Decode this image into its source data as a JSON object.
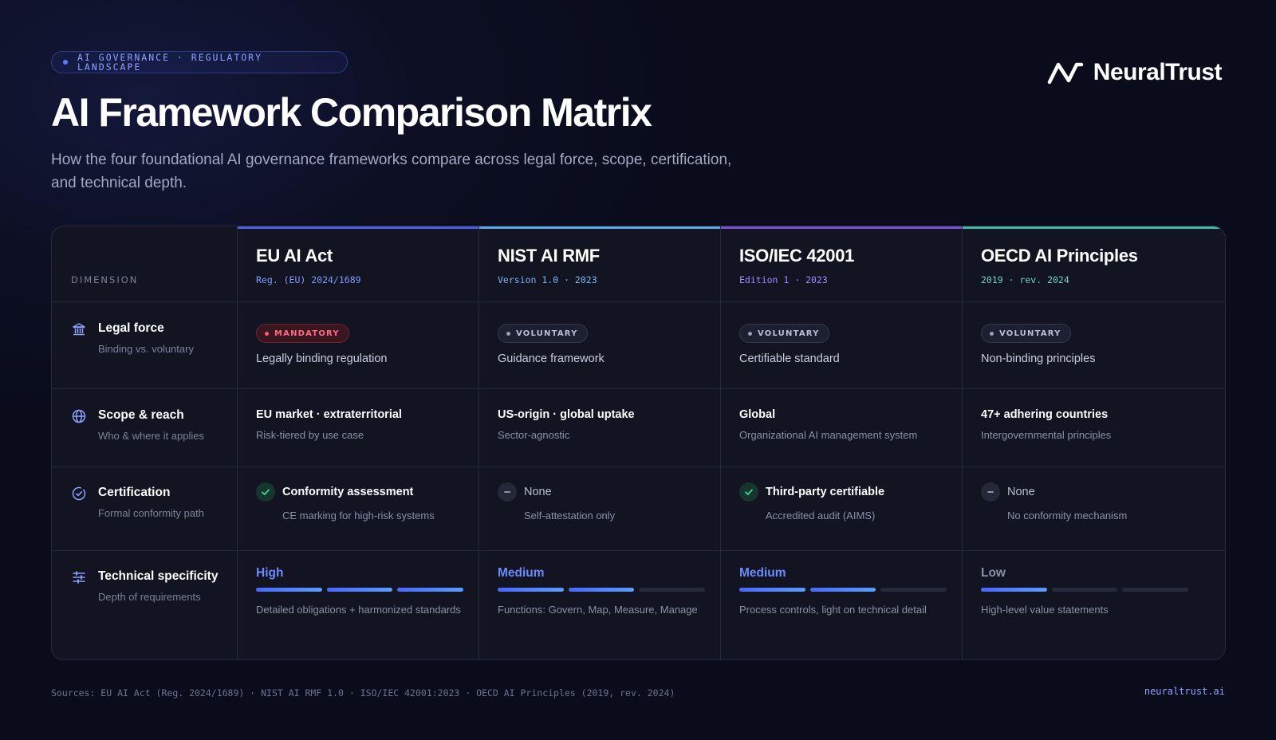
{
  "eyebrow": "AI GOVERNANCE · REGULATORY LANDSCAPE",
  "title": "AI Framework Comparison Matrix",
  "subtitle": "How the four foundational AI governance frameworks compare across legal force, scope, certification, and technical depth.",
  "brand": "NeuralTrust",
  "dimension_label": "DIMENSION",
  "frameworks": [
    {
      "name": "EU AI Act",
      "meta": "Reg. (EU) 2024/1689",
      "accent": "#4a5fe6",
      "meta_color": "#7f9bff"
    },
    {
      "name": "NIST AI RMF",
      "meta": "Version 1.0 · 2023",
      "accent": "#5aa8e8",
      "meta_color": "#7fb6f5"
    },
    {
      "name": "ISO/IEC 42001",
      "meta": "Edition 1 · 2023",
      "accent": "#7a4fd8",
      "meta_color": "#9d8bff"
    },
    {
      "name": "OECD AI Principles",
      "meta": "2019 · rev. 2024",
      "accent": "#3fb8a8",
      "meta_color": "#6fd4c4"
    }
  ],
  "rows": {
    "legal": {
      "title": "Legal force",
      "subtitle": "Binding vs. voluntary",
      "icon": "institution-icon"
    },
    "scope": {
      "title": "Scope & reach",
      "subtitle": "Who & where it applies",
      "icon": "globe-icon"
    },
    "cert": {
      "title": "Certification",
      "subtitle": "Formal conformity path",
      "icon": "badge-check-icon"
    },
    "tech": {
      "title": "Technical specificity",
      "subtitle": "Depth of requirements",
      "icon": "sliders-icon"
    }
  },
  "legal": [
    {
      "badge": "MANDATORY",
      "type": "mandatory",
      "desc": "Legally binding regulation"
    },
    {
      "badge": "VOLUNTARY",
      "type": "voluntary",
      "desc": "Guidance framework"
    },
    {
      "badge": "VOLUNTARY",
      "type": "voluntary",
      "desc": "Certifiable standard"
    },
    {
      "badge": "VOLUNTARY",
      "type": "voluntary",
      "desc": "Non-binding principles"
    }
  ],
  "scope": [
    {
      "title": "EU market · extraterritorial",
      "subtitle": "Risk-tiered by use case"
    },
    {
      "title": "US-origin · global uptake",
      "subtitle": "Sector-agnostic"
    },
    {
      "title": "Global",
      "subtitle": "Organizational AI management system"
    },
    {
      "title": "47+ adhering countries",
      "subtitle": "Intergovernmental principles"
    }
  ],
  "cert": [
    {
      "status": "yes",
      "title": "Conformity assessment",
      "subtitle": "CE marking for high-risk systems"
    },
    {
      "status": "no",
      "title": "None",
      "subtitle": "Self-attestation only"
    },
    {
      "status": "yes",
      "title": "Third-party certifiable",
      "subtitle": "Accredited audit (AIMS)"
    },
    {
      "status": "no",
      "title": "None",
      "subtitle": "No conformity mechanism"
    }
  ],
  "tech": [
    {
      "level": "High",
      "filled": 3,
      "total": 3,
      "desc": "Detailed obligations + harmonized standards"
    },
    {
      "level": "Medium",
      "filled": 2,
      "total": 3,
      "desc": "Functions: Govern, Map, Measure, Manage"
    },
    {
      "level": "Medium",
      "filled": 2,
      "total": 3,
      "desc": "Process controls, light on technical detail"
    },
    {
      "level": "Low",
      "filled": 1,
      "total": 3,
      "desc": "High-level value statements"
    }
  ],
  "footer": {
    "sources": "Sources: EU AI Act (Reg. 2024/1689) · NIST AI RMF 1.0 · ISO/IEC 42001:2023 · OECD AI Principles (2019, rev. 2024)",
    "site": "neuraltrust.ai"
  }
}
